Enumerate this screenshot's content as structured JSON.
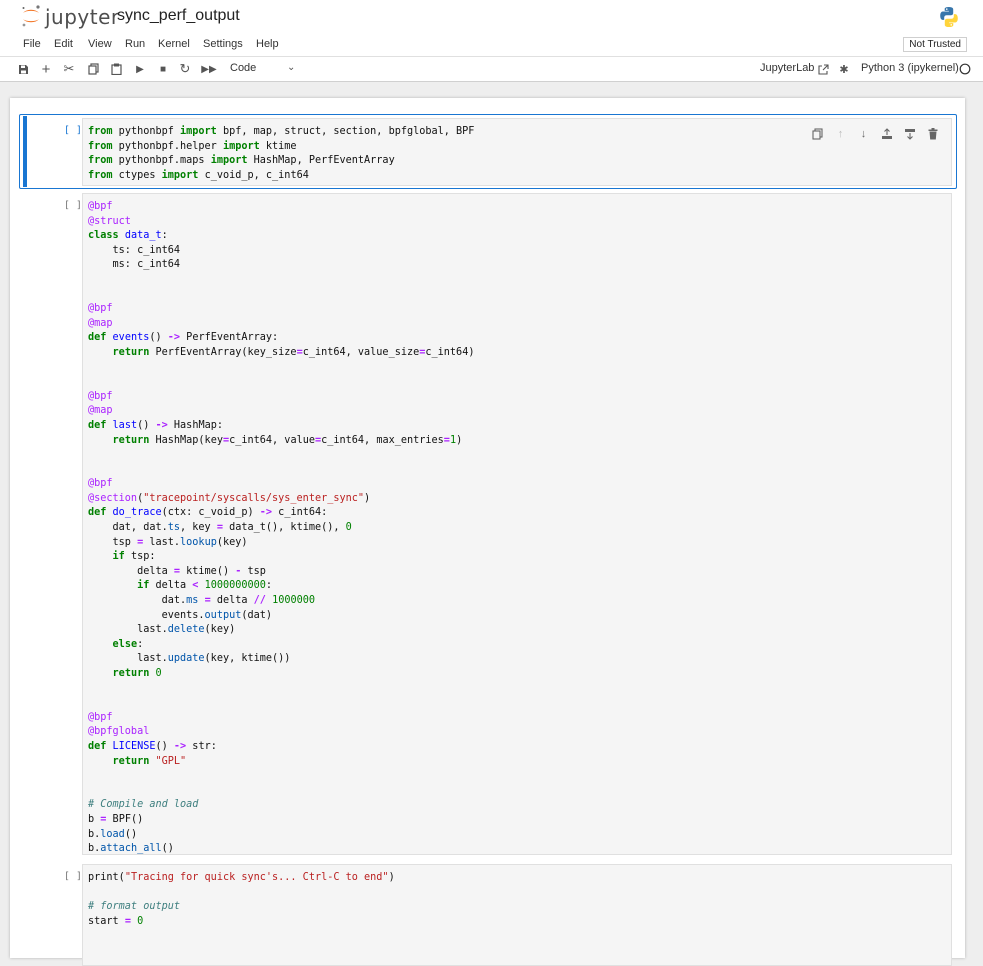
{
  "app": {
    "brand": "jupyter",
    "notebook_title": "sync_perf_output"
  },
  "menu": {
    "items": [
      "File",
      "Edit",
      "View",
      "Run",
      "Kernel",
      "Settings",
      "Help"
    ],
    "trust_label": "Not Trusted"
  },
  "toolbar": {
    "cell_type": "Code",
    "jupyterlab_label": "JupyterLab",
    "kernel_name": "Python 3 (ipykernel)"
  },
  "cells": [
    {
      "prompt": "[ ]:",
      "code": [
        "from pythonbpf import bpf, map, struct, section, bpfglobal, BPF",
        "from pythonbpf.helper import ktime",
        "from pythonbpf.maps import HashMap, PerfEventArray",
        "from ctypes import c_void_p, c_int64"
      ]
    },
    {
      "prompt": "[ ]:",
      "code": [
        "@bpf",
        "@struct",
        "class data_t:",
        "    ts: c_int64",
        "    ms: c_int64",
        "",
        "",
        "@bpf",
        "@map",
        "def events() -> PerfEventArray:",
        "    return PerfEventArray(key_size=c_int64, value_size=c_int64)",
        "",
        "",
        "@bpf",
        "@map",
        "def last() -> HashMap:",
        "    return HashMap(key=c_int64, value=c_int64, max_entries=1)",
        "",
        "",
        "@bpf",
        "@section(\"tracepoint/syscalls/sys_enter_sync\")",
        "def do_trace(ctx: c_void_p) -> c_int64:",
        "    dat, dat.ts, key = data_t(), ktime(), 0",
        "    tsp = last.lookup(key)",
        "    if tsp:",
        "        delta = ktime() - tsp",
        "        if delta < 1000000000:",
        "            dat.ms = delta // 1000000",
        "            events.output(dat)",
        "        last.delete(key)",
        "    else:",
        "        last.update(key, ktime())",
        "    return 0",
        "",
        "",
        "@bpf",
        "@bpfglobal",
        "def LICENSE() -> str:",
        "    return \"GPL\"",
        "",
        "",
        "# Compile and load",
        "b = BPF()",
        "b.load()",
        "b.attach_all()"
      ]
    },
    {
      "prompt": "[ ]:",
      "code": [
        "print(\"Tracing for quick sync's... Ctrl-C to end\")",
        "",
        "# format output",
        "start = 0"
      ]
    }
  ],
  "colors": {
    "accent": "#1976d2",
    "jupyter_orange": "#f37626"
  }
}
